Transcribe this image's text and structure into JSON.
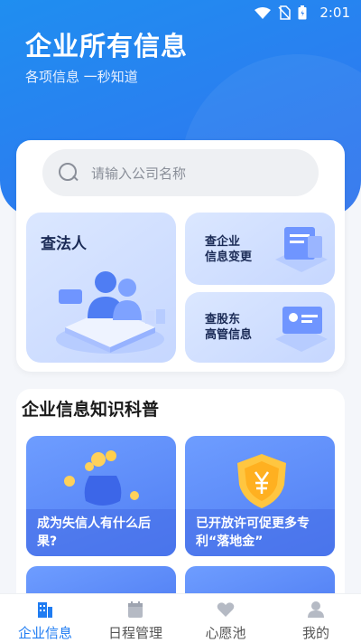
{
  "status": {
    "time": "2:01"
  },
  "hero": {
    "title": "企业所有信息",
    "subtitle": "各项信息 一秒知道"
  },
  "search": {
    "placeholder": "请输入公司名称"
  },
  "tiles": {
    "big": "查法人",
    "small1": "查企业\n信息变更",
    "small2": "查股东\n高管信息"
  },
  "knowledge": {
    "title": "企业信息知识科普",
    "articles": [
      {
        "title": "成为失信人有什么后果?"
      },
      {
        "title": "已开放许可促更多专利“落地金”"
      }
    ]
  },
  "tabs": [
    {
      "label": "企业信息",
      "icon": "buildings-icon"
    },
    {
      "label": "日程管理",
      "icon": "calendar-icon"
    },
    {
      "label": "心愿池",
      "icon": "heart-icon"
    },
    {
      "label": "我的",
      "icon": "user-icon"
    }
  ],
  "colors": {
    "accent": "#1f7cf2",
    "hero_bg": "#2a7ff0"
  }
}
